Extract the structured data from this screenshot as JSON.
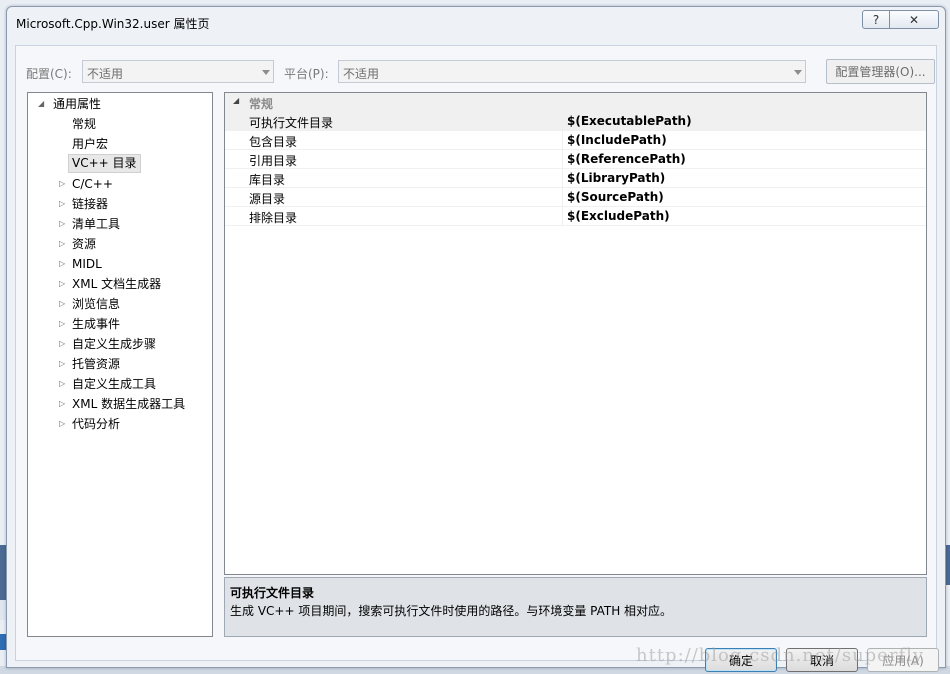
{
  "window": {
    "title": "Microsoft.Cpp.Win32.user 属性页",
    "help_glyph": "?",
    "close_glyph": "✕"
  },
  "config_bar": {
    "config_label": "配置(C):",
    "config_value": "不适用",
    "platform_label": "平台(P):",
    "platform_value": "不适用",
    "config_manager_label": "配置管理器(O)..."
  },
  "tree": {
    "root": "通用属性",
    "items": [
      {
        "label": "常规",
        "expandable": false
      },
      {
        "label": "用户宏",
        "expandable": false
      },
      {
        "label": "VC++ 目录",
        "expandable": false,
        "selected": true
      },
      {
        "label": "C/C++",
        "expandable": true
      },
      {
        "label": "链接器",
        "expandable": true
      },
      {
        "label": "清单工具",
        "expandable": true
      },
      {
        "label": "资源",
        "expandable": true
      },
      {
        "label": "MIDL",
        "expandable": true
      },
      {
        "label": "XML 文档生成器",
        "expandable": true
      },
      {
        "label": "浏览信息",
        "expandable": true
      },
      {
        "label": "生成事件",
        "expandable": true
      },
      {
        "label": "自定义生成步骤",
        "expandable": true
      },
      {
        "label": "托管资源",
        "expandable": true
      },
      {
        "label": "自定义生成工具",
        "expandable": true
      },
      {
        "label": "XML 数据生成器工具",
        "expandable": true
      },
      {
        "label": "代码分析",
        "expandable": true
      }
    ]
  },
  "grid": {
    "category": "常规",
    "rows": [
      {
        "name": "可执行文件目录",
        "value": "$(ExecutablePath)"
      },
      {
        "name": "包含目录",
        "value": "$(IncludePath)"
      },
      {
        "name": "引用目录",
        "value": "$(ReferencePath)"
      },
      {
        "name": "库目录",
        "value": "$(LibraryPath)"
      },
      {
        "name": "源目录",
        "value": "$(SourcePath)"
      },
      {
        "name": "排除目录",
        "value": "$(ExcludePath)"
      }
    ]
  },
  "description": {
    "title": "可执行文件目录",
    "text": "生成 VC++ 项目期间，搜索可执行文件时使用的路径。与环境变量 PATH 相对应。"
  },
  "buttons": {
    "ok": "确定",
    "cancel": "取消",
    "apply": "应用(A)"
  },
  "watermark": "http://blog.csdn.net/superfly"
}
